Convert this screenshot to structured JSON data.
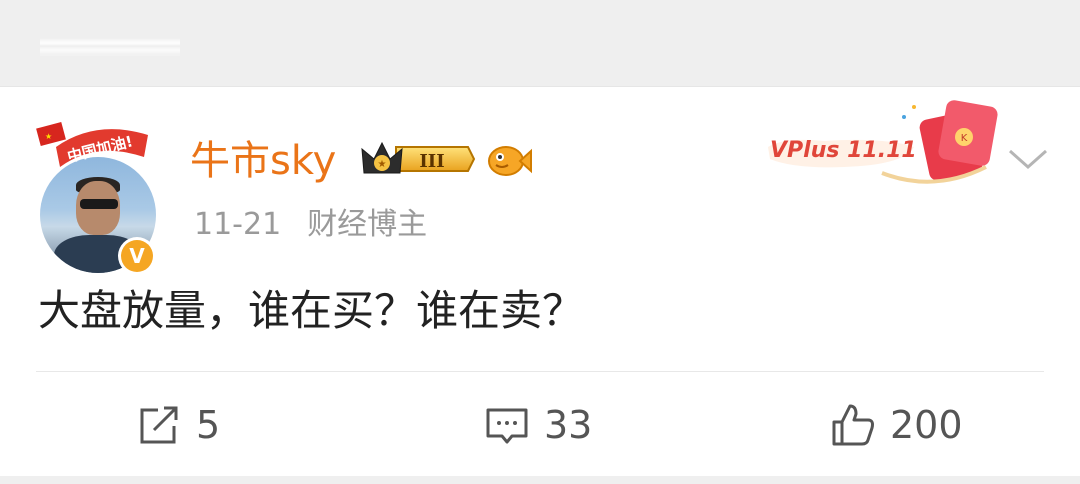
{
  "post": {
    "username": "牛市sky",
    "membership_badge": "III",
    "date": "11-21",
    "source": "财经博主",
    "text": "大盘放量，谁在买？谁在卖？",
    "avatar_frame_text": "中国加油!",
    "verified_mark": "V"
  },
  "promo": {
    "label": "VPlus 11.11",
    "icon": "red-envelope-icon"
  },
  "actions": {
    "repost_count": "5",
    "comment_count": "33",
    "like_count": "200"
  },
  "colors": {
    "username": "#ea7418",
    "meta": "#9a9a9a",
    "body_text": "#222222",
    "action_text": "#555555",
    "verified": "#f5a623"
  }
}
